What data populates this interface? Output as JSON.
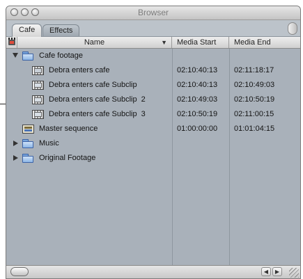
{
  "window": {
    "title": "Browser",
    "tabs": [
      {
        "label": "Cafe",
        "active": true
      },
      {
        "label": "Effects",
        "active": false
      }
    ]
  },
  "columns": {
    "name": "Name",
    "sort_glyph": "▼",
    "start": "Media Start",
    "end": "Media End"
  },
  "rows": [
    {
      "name": "Cafe footage",
      "type": "bin",
      "expanded": true,
      "start": "",
      "end": ""
    },
    {
      "name": "Debra enters cafe",
      "type": "clip",
      "start": "02:10:40:13",
      "end": "02:11:18:17"
    },
    {
      "name": "Debra enters cafe Subclip",
      "type": "subclip",
      "start": "02:10:40:13",
      "end": "02:10:49:03"
    },
    {
      "name": "Debra enters cafe Subclip  2",
      "type": "subclip",
      "start": "02:10:49:03",
      "end": "02:10:50:19"
    },
    {
      "name": "Debra enters cafe Subclip  3",
      "type": "subclip",
      "start": "02:10:50:19",
      "end": "02:11:00:15"
    },
    {
      "name": "Master sequence",
      "type": "sequence",
      "start": "01:00:00:00",
      "end": "01:01:04:15"
    },
    {
      "name": "Music",
      "type": "bin",
      "expanded": false,
      "start": "",
      "end": ""
    },
    {
      "name": "Original Footage",
      "type": "bin",
      "expanded": false,
      "start": "",
      "end": ""
    }
  ],
  "statusbar": {
    "left_arrow": "◀",
    "right_arrow": "▶"
  },
  "icons": {
    "clapboard": "clapboard-icon",
    "folder": "bin-folder-icon",
    "clip": "clip-icon",
    "subclip": "subclip-icon",
    "sequence": "sequence-icon"
  }
}
